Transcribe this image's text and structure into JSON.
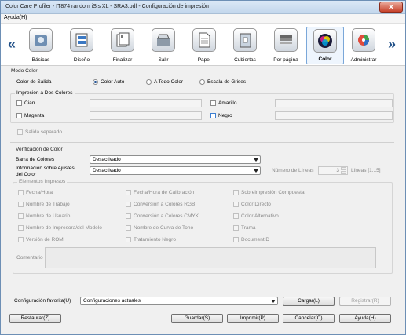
{
  "window": {
    "title": "Color Care Profiler - IT874 random iSis XL - SRA3.pdf - Configuración de impresión",
    "close_glyph": "✕"
  },
  "menu": {
    "ayuda_label": "Ayuda(H)",
    "ayuda_prefix": "Ayuda(",
    "ayuda_hotkey": "H",
    "ayuda_suffix": ")"
  },
  "toolbar": {
    "left_arrow": "«",
    "right_arrow": "»",
    "items": [
      {
        "label": "Básicas",
        "icon": "basic-settings-icon"
      },
      {
        "label": "Diseño",
        "icon": "layout-icon"
      },
      {
        "label": "Finalizar",
        "icon": "finishing-icon"
      },
      {
        "label": "Salir",
        "icon": "output-icon"
      },
      {
        "label": "Papel",
        "icon": "paper-icon"
      },
      {
        "label": "Cubiertas",
        "icon": "covers-icon"
      },
      {
        "label": "Por página",
        "icon": "per-page-icon"
      },
      {
        "label": "Color",
        "icon": "color-icon",
        "selected": true
      },
      {
        "label": "Administrar",
        "icon": "manage-icon"
      }
    ]
  },
  "modo_color": {
    "section": "Modo Color",
    "salida_label": "Color de Salida",
    "options": [
      "Color Auto",
      "A Todo Color",
      "Escala de Grises"
    ],
    "selected": "Color Auto"
  },
  "impresion": {
    "legend": "Impresión a Dos Colores",
    "cian": "Cian",
    "magenta": "Magenta",
    "amarillo": "Amarillo",
    "negro": "Negro",
    "salida_separado": "Salida separado"
  },
  "verificacion": {
    "legend": "Verificación de Color",
    "barra_label": "Barra de Colores",
    "barra_value": "Desactivado",
    "info_label_1": "Informacion sobre Ajustes",
    "info_label_2": "del Color",
    "info_value": "Desactivado",
    "num_lineas_label": "Número de Líneas",
    "num_lineas_value": "3",
    "lineas_range": "Líneas [1...5]"
  },
  "elementos": {
    "legend": "Elementos Impresos",
    "col1": [
      "Fecha/Hora",
      "Nombre de Trabajo",
      "Nombre de Usuario",
      "Nombre de Impresora/del Modelo",
      "Versión de ROM"
    ],
    "col2": [
      "Fecha/Hora de Calibración",
      "Conversión a Colores RGB",
      "Conversión a Colores CMYK",
      "Nombre de Curva de Tono",
      "Tratamiento Negro"
    ],
    "col3": [
      "Sobreimpresión Compuesta",
      "Color Directo",
      "Color Alternativo",
      "Trama",
      "DocumentID"
    ],
    "comentario": "Comentario"
  },
  "favorita": {
    "label": "Configuración favorita(U)",
    "value": "Configuraciones actuales",
    "cargar": "Cargar(L)",
    "registrar": "Registrar(R)"
  },
  "footer": {
    "restaurar": "Restaurar(Z)",
    "guardar": "Guardar(S)",
    "imprimir": "Imprimir(P)",
    "cancelar": "Cancelar(C)",
    "ayuda": "Ayuda(H)"
  }
}
